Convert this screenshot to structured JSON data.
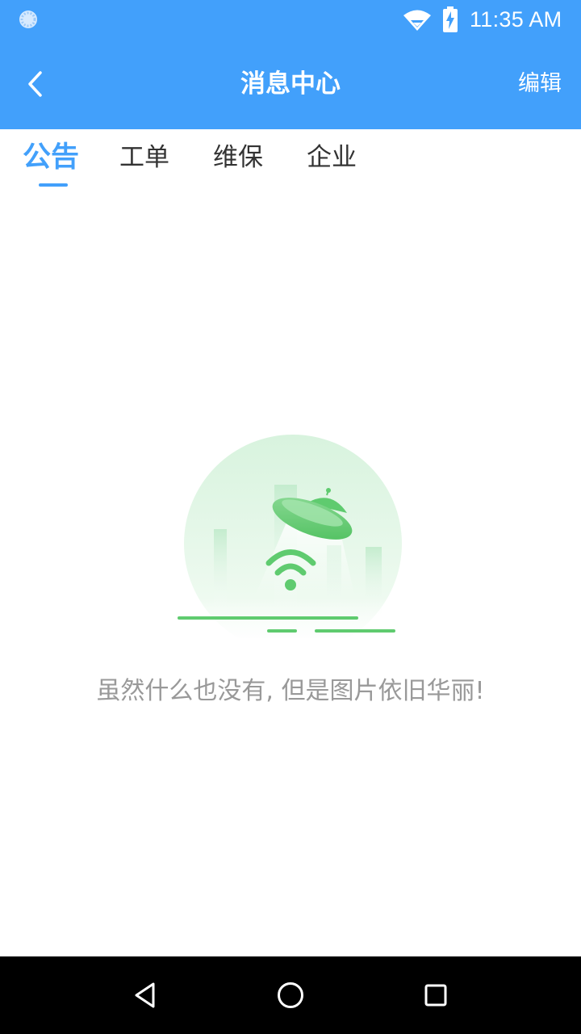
{
  "status_bar": {
    "time": "11:35 AM",
    "icons": [
      "sync-icon",
      "wifi-icon",
      "battery-charging-icon"
    ]
  },
  "app_bar": {
    "back_icon": "chevron-left-icon",
    "title": "消息中心",
    "edit_label": "编辑",
    "background_color": "#42a0fb"
  },
  "tabs": [
    {
      "label": "公告",
      "active": true
    },
    {
      "label": "工单",
      "active": false
    },
    {
      "label": "维保",
      "active": false
    },
    {
      "label": "企业",
      "active": false
    }
  ],
  "empty_state": {
    "illustration": "ufo-wifi-illustration",
    "message": "虽然什么也没有, 但是图片依旧华丽!"
  },
  "nav_bar": {
    "icons": [
      "back-triangle-icon",
      "home-circle-icon",
      "recents-square-icon"
    ]
  },
  "colors": {
    "accent": "#42a0fb",
    "illustration_green": "#5fcb6f",
    "tab_inactive": "#333333",
    "empty_text": "#999999"
  }
}
